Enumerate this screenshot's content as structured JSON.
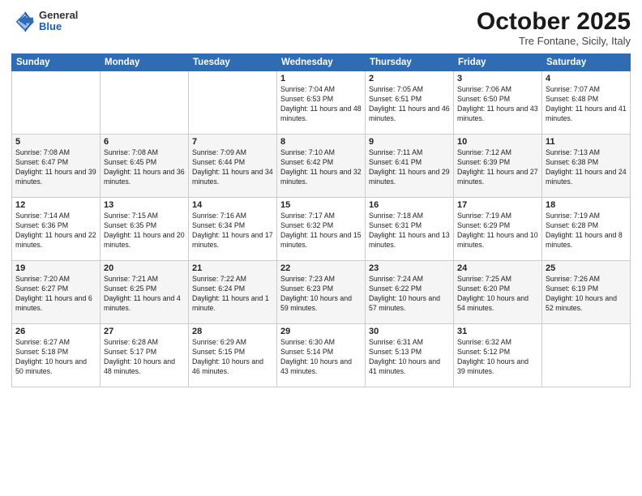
{
  "header": {
    "logo_general": "General",
    "logo_blue": "Blue",
    "month_title": "October 2025",
    "subtitle": "Tre Fontane, Sicily, Italy"
  },
  "days_of_week": [
    "Sunday",
    "Monday",
    "Tuesday",
    "Wednesday",
    "Thursday",
    "Friday",
    "Saturday"
  ],
  "weeks": [
    [
      {
        "day": "",
        "info": ""
      },
      {
        "day": "",
        "info": ""
      },
      {
        "day": "",
        "info": ""
      },
      {
        "day": "1",
        "info": "Sunrise: 7:04 AM\nSunset: 6:53 PM\nDaylight: 11 hours and 48 minutes."
      },
      {
        "day": "2",
        "info": "Sunrise: 7:05 AM\nSunset: 6:51 PM\nDaylight: 11 hours and 46 minutes."
      },
      {
        "day": "3",
        "info": "Sunrise: 7:06 AM\nSunset: 6:50 PM\nDaylight: 11 hours and 43 minutes."
      },
      {
        "day": "4",
        "info": "Sunrise: 7:07 AM\nSunset: 6:48 PM\nDaylight: 11 hours and 41 minutes."
      }
    ],
    [
      {
        "day": "5",
        "info": "Sunrise: 7:08 AM\nSunset: 6:47 PM\nDaylight: 11 hours and 39 minutes."
      },
      {
        "day": "6",
        "info": "Sunrise: 7:08 AM\nSunset: 6:45 PM\nDaylight: 11 hours and 36 minutes."
      },
      {
        "day": "7",
        "info": "Sunrise: 7:09 AM\nSunset: 6:44 PM\nDaylight: 11 hours and 34 minutes."
      },
      {
        "day": "8",
        "info": "Sunrise: 7:10 AM\nSunset: 6:42 PM\nDaylight: 11 hours and 32 minutes."
      },
      {
        "day": "9",
        "info": "Sunrise: 7:11 AM\nSunset: 6:41 PM\nDaylight: 11 hours and 29 minutes."
      },
      {
        "day": "10",
        "info": "Sunrise: 7:12 AM\nSunset: 6:39 PM\nDaylight: 11 hours and 27 minutes."
      },
      {
        "day": "11",
        "info": "Sunrise: 7:13 AM\nSunset: 6:38 PM\nDaylight: 11 hours and 24 minutes."
      }
    ],
    [
      {
        "day": "12",
        "info": "Sunrise: 7:14 AM\nSunset: 6:36 PM\nDaylight: 11 hours and 22 minutes."
      },
      {
        "day": "13",
        "info": "Sunrise: 7:15 AM\nSunset: 6:35 PM\nDaylight: 11 hours and 20 minutes."
      },
      {
        "day": "14",
        "info": "Sunrise: 7:16 AM\nSunset: 6:34 PM\nDaylight: 11 hours and 17 minutes."
      },
      {
        "day": "15",
        "info": "Sunrise: 7:17 AM\nSunset: 6:32 PM\nDaylight: 11 hours and 15 minutes."
      },
      {
        "day": "16",
        "info": "Sunrise: 7:18 AM\nSunset: 6:31 PM\nDaylight: 11 hours and 13 minutes."
      },
      {
        "day": "17",
        "info": "Sunrise: 7:19 AM\nSunset: 6:29 PM\nDaylight: 11 hours and 10 minutes."
      },
      {
        "day": "18",
        "info": "Sunrise: 7:19 AM\nSunset: 6:28 PM\nDaylight: 11 hours and 8 minutes."
      }
    ],
    [
      {
        "day": "19",
        "info": "Sunrise: 7:20 AM\nSunset: 6:27 PM\nDaylight: 11 hours and 6 minutes."
      },
      {
        "day": "20",
        "info": "Sunrise: 7:21 AM\nSunset: 6:25 PM\nDaylight: 11 hours and 4 minutes."
      },
      {
        "day": "21",
        "info": "Sunrise: 7:22 AM\nSunset: 6:24 PM\nDaylight: 11 hours and 1 minute."
      },
      {
        "day": "22",
        "info": "Sunrise: 7:23 AM\nSunset: 6:23 PM\nDaylight: 10 hours and 59 minutes."
      },
      {
        "day": "23",
        "info": "Sunrise: 7:24 AM\nSunset: 6:22 PM\nDaylight: 10 hours and 57 minutes."
      },
      {
        "day": "24",
        "info": "Sunrise: 7:25 AM\nSunset: 6:20 PM\nDaylight: 10 hours and 54 minutes."
      },
      {
        "day": "25",
        "info": "Sunrise: 7:26 AM\nSunset: 6:19 PM\nDaylight: 10 hours and 52 minutes."
      }
    ],
    [
      {
        "day": "26",
        "info": "Sunrise: 6:27 AM\nSunset: 5:18 PM\nDaylight: 10 hours and 50 minutes."
      },
      {
        "day": "27",
        "info": "Sunrise: 6:28 AM\nSunset: 5:17 PM\nDaylight: 10 hours and 48 minutes."
      },
      {
        "day": "28",
        "info": "Sunrise: 6:29 AM\nSunset: 5:15 PM\nDaylight: 10 hours and 46 minutes."
      },
      {
        "day": "29",
        "info": "Sunrise: 6:30 AM\nSunset: 5:14 PM\nDaylight: 10 hours and 43 minutes."
      },
      {
        "day": "30",
        "info": "Sunrise: 6:31 AM\nSunset: 5:13 PM\nDaylight: 10 hours and 41 minutes."
      },
      {
        "day": "31",
        "info": "Sunrise: 6:32 AM\nSunset: 5:12 PM\nDaylight: 10 hours and 39 minutes."
      },
      {
        "day": "",
        "info": ""
      }
    ]
  ]
}
